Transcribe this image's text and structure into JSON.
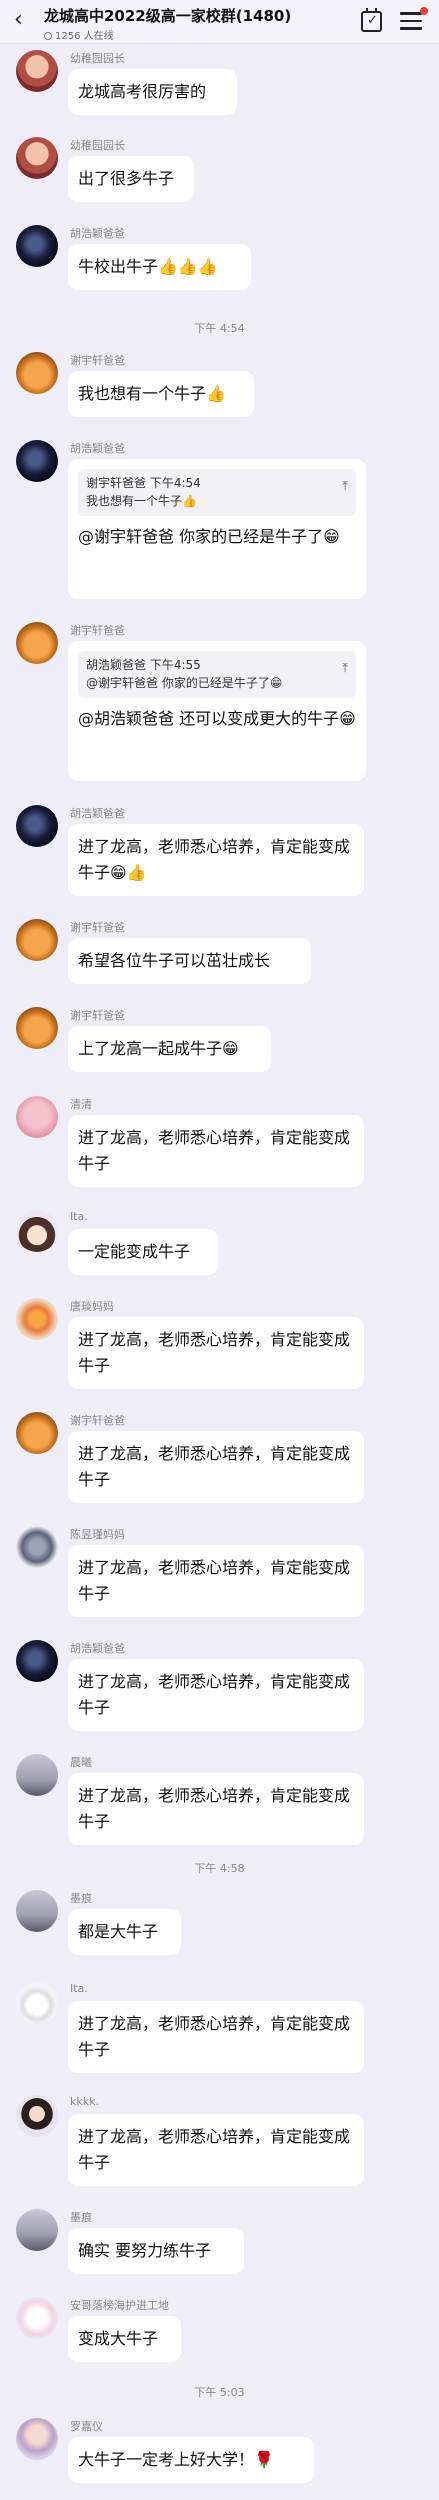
{
  "header": {
    "back_icon": "‹",
    "title": "龙城高中2022级高一家校群(1480)",
    "online": "1256 人在线"
  },
  "messages": [
    {
      "name": "幼稚园园长",
      "text": "龙城高考很厉害的"
    },
    {
      "name": "幼稚园园长",
      "text": "出了很多牛子"
    },
    {
      "name": "胡浩颖爸爸",
      "text": "牛校出牛子👍👍👍"
    },
    {
      "time": "下午 4:54"
    },
    {
      "name": "谢宇轩爸爸",
      "text": "我也想有一个牛子👍"
    },
    {
      "name": "胡浩颖爸爸",
      "quote_header": "谢宇轩爸爸 下午4:54",
      "quote_text": "我也想有一个牛子👍",
      "text": "@谢宇轩爸爸 你家的已经是牛子了😁"
    },
    {
      "name": "谢宇轩爸爸",
      "quote_header": "胡浩颖爸爸 下午4:55",
      "quote_text": "@谢宇轩爸爸 你家的已经是牛子了😁",
      "text": "@胡浩颖爸爸 还可以变成更大的牛子😁"
    },
    {
      "name": "胡浩颖爸爸",
      "text": "进了龙高，老师悉心培养，肯定能变成牛子😁👍"
    },
    {
      "name": "谢宇轩爸爸",
      "text": "希望各位牛子可以茁壮成长"
    },
    {
      "name": "谢宇轩爸爸",
      "text": "上了龙高一起成牛子😁"
    },
    {
      "name": "清清",
      "text": "进了龙高，老师悉心培养，肯定能变成牛子"
    },
    {
      "name": "Ita.",
      "text": "一定能变成牛子"
    },
    {
      "name": "唐琰妈妈",
      "text": "进了龙高，老师悉心培养，肯定能变成牛子"
    },
    {
      "name": "谢宇轩爸爸",
      "text": "进了龙高，老师悉心培养，肯定能变成牛子"
    },
    {
      "name": "陈昱瑾妈妈",
      "text": "进了龙高，老师悉心培养，肯定能变成牛子"
    },
    {
      "name": "胡浩颖爸爸",
      "text": "进了龙高，老师悉心培养，肯定能变成牛子"
    },
    {
      "name": "晨曦",
      "text": "进了龙高，老师悉心培养，肯定能变成牛子"
    },
    {
      "time": "下午 4:58"
    },
    {
      "name": "墨痕",
      "text": "都是大牛子"
    },
    {
      "name": "Ita.",
      "text": "进了龙高，老师悉心培养，肯定能变成牛子"
    },
    {
      "name": "kkkk.",
      "text": "进了龙高，老师悉心培养，肯定能变成牛子"
    },
    {
      "name": "墨痕",
      "text": "确实 要努力练牛子"
    },
    {
      "name": "安哥落榜海护进工地",
      "text": "变成大牛子"
    },
    {
      "time": "下午 5:03"
    },
    {
      "name": "罗嘉仪",
      "text": "大牛子一定考上好大学！🌹"
    }
  ]
}
